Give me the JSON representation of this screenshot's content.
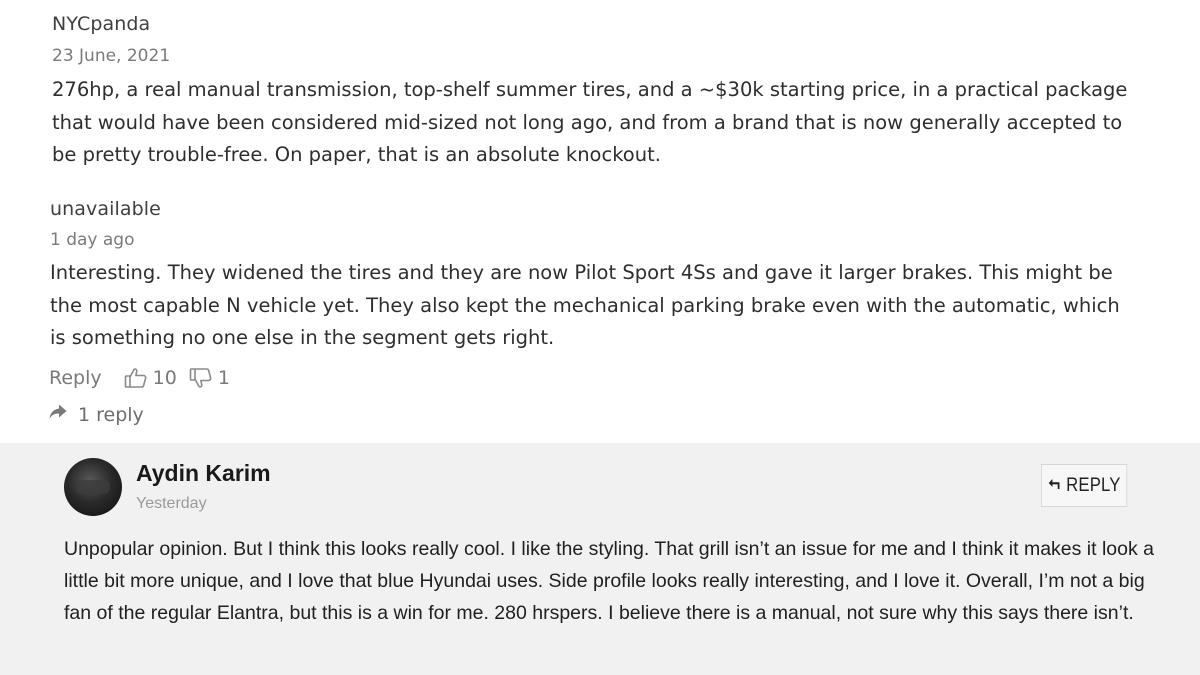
{
  "comments": [
    {
      "username": "NYCpanda",
      "date": "23 June, 2021",
      "text": "276hp, a real manual transmission, top-shelf summer tires, and a ~$30k starting price, in a practical package that would have been considered mid-sized not long ago, and from a brand that is now generally accepted to be pretty trouble-free. On paper, that is an absolute knockout."
    },
    {
      "username": "unavailable",
      "date": "1 day ago",
      "text": "Interesting. They widened the tires and they are now Pilot Sport 4Ss and gave it larger brakes. This might be the most capable N vehicle yet. They also kept the mechanical parking brake even with the automatic, which is something no one else in the segment gets right.",
      "reply_label": "Reply",
      "upvotes": "10",
      "downvotes": "1",
      "replies_label": "1 reply"
    }
  ],
  "reply_post": {
    "author": "Aydin Karim",
    "date": "Yesterday",
    "reply_button_label": "REPLY",
    "text": "Unpopular opinion. But I think this looks really cool. I like the styling. That grill isn’t an issue for me and I think it makes it look a little bit more unique, and I love that blue Hyundai uses. Side profile looks really interesting, and I love it. Overall, I’m not a big fan of the regular Elantra, but this is a win for me. 280 hrspers. I believe there is a manual, not sure why this says there isn’t."
  },
  "icons": {
    "thumbs_up": "thumbs-up-icon",
    "thumbs_down": "thumbs-down-icon",
    "reply_thread": "share-arrow-icon",
    "reply_button": "reply-arrow-icon"
  },
  "colors": {
    "panel_background": "#f1f1f1",
    "muted_text": "#7a7a7a"
  }
}
